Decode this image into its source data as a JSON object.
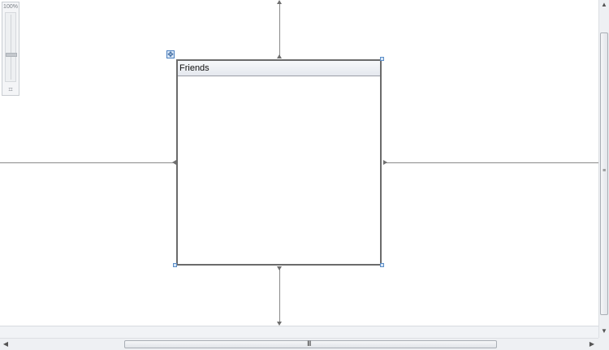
{
  "zoom": {
    "level": "100%",
    "fit_icon": "fit-to-screen-icon",
    "slider_fraction": 0.62
  },
  "element": {
    "header_text": "Friends"
  },
  "icons": {
    "move": "move-handle-icon",
    "scroll_up": "▲",
    "scroll_down": "▼",
    "scroll_left": "◀",
    "scroll_right": "▶",
    "grip": "III"
  },
  "colors": {
    "connector": "#8a8a8a",
    "selection": "#5a8dc7",
    "border": "#6b6b6b"
  }
}
